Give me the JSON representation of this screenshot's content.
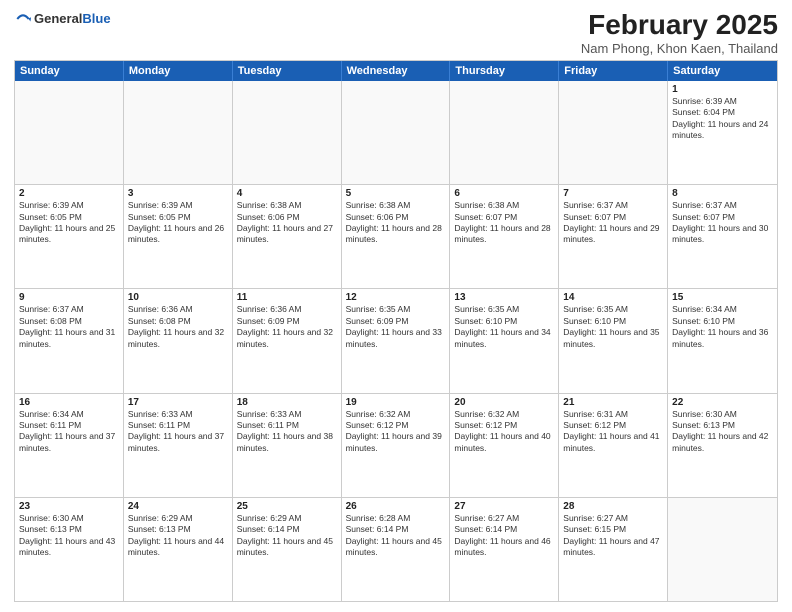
{
  "header": {
    "logo_general": "General",
    "logo_blue": "Blue",
    "title": "February 2025",
    "subtitle": "Nam Phong, Khon Kaen, Thailand"
  },
  "weekdays": [
    "Sunday",
    "Monday",
    "Tuesday",
    "Wednesday",
    "Thursday",
    "Friday",
    "Saturday"
  ],
  "weeks": [
    [
      {
        "day": "",
        "text": ""
      },
      {
        "day": "",
        "text": ""
      },
      {
        "day": "",
        "text": ""
      },
      {
        "day": "",
        "text": ""
      },
      {
        "day": "",
        "text": ""
      },
      {
        "day": "",
        "text": ""
      },
      {
        "day": "1",
        "text": "Sunrise: 6:39 AM\nSunset: 6:04 PM\nDaylight: 11 hours and 24 minutes."
      }
    ],
    [
      {
        "day": "2",
        "text": "Sunrise: 6:39 AM\nSunset: 6:05 PM\nDaylight: 11 hours and 25 minutes."
      },
      {
        "day": "3",
        "text": "Sunrise: 6:39 AM\nSunset: 6:05 PM\nDaylight: 11 hours and 26 minutes."
      },
      {
        "day": "4",
        "text": "Sunrise: 6:38 AM\nSunset: 6:06 PM\nDaylight: 11 hours and 27 minutes."
      },
      {
        "day": "5",
        "text": "Sunrise: 6:38 AM\nSunset: 6:06 PM\nDaylight: 11 hours and 28 minutes."
      },
      {
        "day": "6",
        "text": "Sunrise: 6:38 AM\nSunset: 6:07 PM\nDaylight: 11 hours and 28 minutes."
      },
      {
        "day": "7",
        "text": "Sunrise: 6:37 AM\nSunset: 6:07 PM\nDaylight: 11 hours and 29 minutes."
      },
      {
        "day": "8",
        "text": "Sunrise: 6:37 AM\nSunset: 6:07 PM\nDaylight: 11 hours and 30 minutes."
      }
    ],
    [
      {
        "day": "9",
        "text": "Sunrise: 6:37 AM\nSunset: 6:08 PM\nDaylight: 11 hours and 31 minutes."
      },
      {
        "day": "10",
        "text": "Sunrise: 6:36 AM\nSunset: 6:08 PM\nDaylight: 11 hours and 32 minutes."
      },
      {
        "day": "11",
        "text": "Sunrise: 6:36 AM\nSunset: 6:09 PM\nDaylight: 11 hours and 32 minutes."
      },
      {
        "day": "12",
        "text": "Sunrise: 6:35 AM\nSunset: 6:09 PM\nDaylight: 11 hours and 33 minutes."
      },
      {
        "day": "13",
        "text": "Sunrise: 6:35 AM\nSunset: 6:10 PM\nDaylight: 11 hours and 34 minutes."
      },
      {
        "day": "14",
        "text": "Sunrise: 6:35 AM\nSunset: 6:10 PM\nDaylight: 11 hours and 35 minutes."
      },
      {
        "day": "15",
        "text": "Sunrise: 6:34 AM\nSunset: 6:10 PM\nDaylight: 11 hours and 36 minutes."
      }
    ],
    [
      {
        "day": "16",
        "text": "Sunrise: 6:34 AM\nSunset: 6:11 PM\nDaylight: 11 hours and 37 minutes."
      },
      {
        "day": "17",
        "text": "Sunrise: 6:33 AM\nSunset: 6:11 PM\nDaylight: 11 hours and 37 minutes."
      },
      {
        "day": "18",
        "text": "Sunrise: 6:33 AM\nSunset: 6:11 PM\nDaylight: 11 hours and 38 minutes."
      },
      {
        "day": "19",
        "text": "Sunrise: 6:32 AM\nSunset: 6:12 PM\nDaylight: 11 hours and 39 minutes."
      },
      {
        "day": "20",
        "text": "Sunrise: 6:32 AM\nSunset: 6:12 PM\nDaylight: 11 hours and 40 minutes."
      },
      {
        "day": "21",
        "text": "Sunrise: 6:31 AM\nSunset: 6:12 PM\nDaylight: 11 hours and 41 minutes."
      },
      {
        "day": "22",
        "text": "Sunrise: 6:30 AM\nSunset: 6:13 PM\nDaylight: 11 hours and 42 minutes."
      }
    ],
    [
      {
        "day": "23",
        "text": "Sunrise: 6:30 AM\nSunset: 6:13 PM\nDaylight: 11 hours and 43 minutes."
      },
      {
        "day": "24",
        "text": "Sunrise: 6:29 AM\nSunset: 6:13 PM\nDaylight: 11 hours and 44 minutes."
      },
      {
        "day": "25",
        "text": "Sunrise: 6:29 AM\nSunset: 6:14 PM\nDaylight: 11 hours and 45 minutes."
      },
      {
        "day": "26",
        "text": "Sunrise: 6:28 AM\nSunset: 6:14 PM\nDaylight: 11 hours and 45 minutes."
      },
      {
        "day": "27",
        "text": "Sunrise: 6:27 AM\nSunset: 6:14 PM\nDaylight: 11 hours and 46 minutes."
      },
      {
        "day": "28",
        "text": "Sunrise: 6:27 AM\nSunset: 6:15 PM\nDaylight: 11 hours and 47 minutes."
      },
      {
        "day": "",
        "text": ""
      }
    ]
  ]
}
